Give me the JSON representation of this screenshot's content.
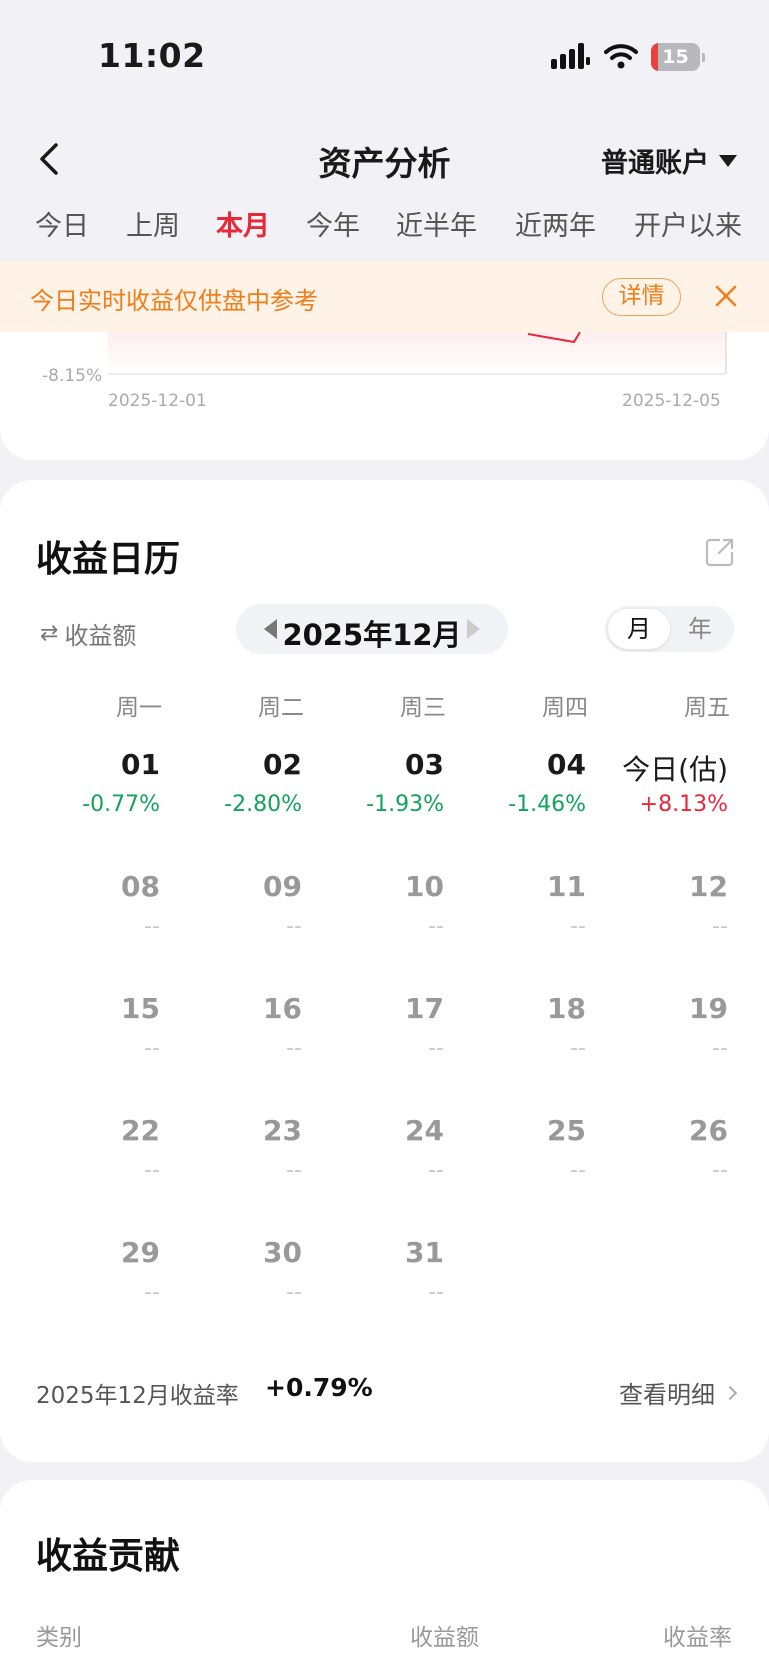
{
  "status_bar": {
    "time": "11:02",
    "battery_level": 15,
    "battery_color": "#e94040"
  },
  "header": {
    "title": "资产分析",
    "account": "普通账户"
  },
  "period_tabs": [
    {
      "label": "今日"
    },
    {
      "label": "上周"
    },
    {
      "label": "本月",
      "active": true
    },
    {
      "label": "今年"
    },
    {
      "label": "近半年"
    },
    {
      "label": "近两年"
    },
    {
      "label": "开户以来"
    }
  ],
  "notice": {
    "text": "今日实时收益仅供盘中参考",
    "detail_label": "详情"
  },
  "chart": {
    "y_min_label": "-8.15%",
    "x_start_label": "2025-12-01",
    "x_end_label": "2025-12-05",
    "line_color": "#e8273a"
  },
  "calendar": {
    "title": "收益日历",
    "metric_label": "收益额",
    "month_label": "2025年12月",
    "view_month": "月",
    "view_year": "年",
    "weekdays": [
      "周一",
      "周二",
      "周三",
      "周四",
      "周五"
    ],
    "weeks": [
      [
        {
          "day": "01",
          "value": "-0.77%",
          "tone": "down"
        },
        {
          "day": "02",
          "value": "-2.80%",
          "tone": "down"
        },
        {
          "day": "03",
          "value": "-1.93%",
          "tone": "down"
        },
        {
          "day": "04",
          "value": "-1.46%",
          "tone": "down"
        },
        {
          "day": "今日(估)",
          "value": "+8.13%",
          "tone": "up"
        }
      ],
      [
        {
          "day": "08",
          "value": "--",
          "tone": "none"
        },
        {
          "day": "09",
          "value": "--",
          "tone": "none"
        },
        {
          "day": "10",
          "value": "--",
          "tone": "none"
        },
        {
          "day": "11",
          "value": "--",
          "tone": "none"
        },
        {
          "day": "12",
          "value": "--",
          "tone": "none"
        }
      ],
      [
        {
          "day": "15",
          "value": "--",
          "tone": "none"
        },
        {
          "day": "16",
          "value": "--",
          "tone": "none"
        },
        {
          "day": "17",
          "value": "--",
          "tone": "none"
        },
        {
          "day": "18",
          "value": "--",
          "tone": "none"
        },
        {
          "day": "19",
          "value": "--",
          "tone": "none"
        }
      ],
      [
        {
          "day": "22",
          "value": "--",
          "tone": "none"
        },
        {
          "day": "23",
          "value": "--",
          "tone": "none"
        },
        {
          "day": "24",
          "value": "--",
          "tone": "none"
        },
        {
          "day": "25",
          "value": "--",
          "tone": "none"
        },
        {
          "day": "26",
          "value": "--",
          "tone": "none"
        }
      ],
      [
        {
          "day": "29",
          "value": "--",
          "tone": "none"
        },
        {
          "day": "30",
          "value": "--",
          "tone": "none"
        },
        {
          "day": "31",
          "value": "--",
          "tone": "none"
        }
      ]
    ],
    "colors": {
      "up": "#e8273a",
      "down": "#12a35d",
      "none": "#c8c8c8",
      "past_day": "#1a1a1a",
      "future_day": "#999999"
    },
    "summary_label": "2025年12月收益率",
    "summary_value": "+0.79%",
    "detail_link": "查看明细"
  },
  "contribution": {
    "title": "收益贡献",
    "columns": [
      "类别",
      "收益额",
      "收益率"
    ]
  }
}
